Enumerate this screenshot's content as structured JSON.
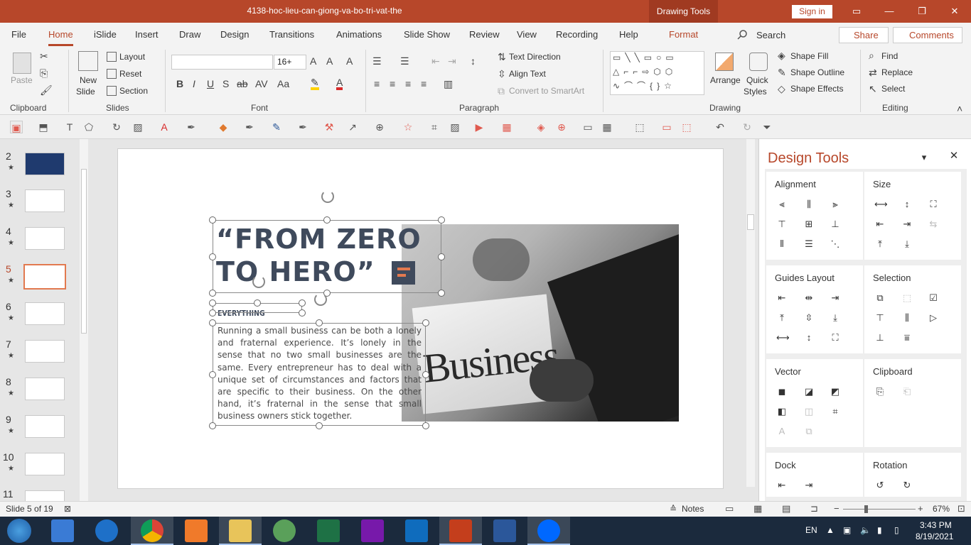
{
  "window": {
    "title": "4138-hoc-lieu-can-giong-va-bo-tri-vat-the",
    "context_tab": "Drawing Tools",
    "signin": "Sign in"
  },
  "tabs": [
    "File",
    "Home",
    "iSlide",
    "Insert",
    "Draw",
    "Design",
    "Transitions",
    "Animations",
    "Slide Show",
    "Review",
    "View",
    "Recording",
    "Help",
    "Format"
  ],
  "search_label": "Search",
  "share_label": "Share",
  "comments_label": "Comments",
  "ribbon": {
    "clipboard": {
      "label": "Clipboard",
      "paste": "Paste"
    },
    "slides": {
      "label": "Slides",
      "new_slide": "New",
      "new_slide2": "Slide",
      "layout": "Layout",
      "reset": "Reset",
      "section": "Section"
    },
    "font": {
      "label": "Font",
      "font_name": "",
      "font_size": "16+"
    },
    "paragraph": {
      "label": "Paragraph",
      "text_direction": "Text Direction",
      "align_text": "Align Text",
      "convert_smartart": "Convert to SmartArt"
    },
    "drawing": {
      "label": "Drawing",
      "arrange": "Arrange",
      "quick_styles": "Quick",
      "quick_styles2": "Styles",
      "shape_fill": "Shape Fill",
      "shape_outline": "Shape Outline",
      "shape_effects": "Shape Effects"
    },
    "editing": {
      "label": "Editing",
      "find": "Find",
      "replace": "Replace",
      "select": "Select"
    }
  },
  "thumbnails": [
    {
      "num": "2",
      "star": "★"
    },
    {
      "num": "3",
      "star": "★"
    },
    {
      "num": "4",
      "star": "★"
    },
    {
      "num": "5",
      "star": "★"
    },
    {
      "num": "6",
      "star": "★"
    },
    {
      "num": "7",
      "star": "★"
    },
    {
      "num": "8",
      "star": "★"
    },
    {
      "num": "9",
      "star": "★"
    },
    {
      "num": "10",
      "star": "★"
    },
    {
      "num": "11",
      "star": ""
    }
  ],
  "slide": {
    "title_line1": "“FROM ZERO",
    "title_line2": "TO HERO”",
    "subtitle": "EVERYTHING",
    "body": "Running a small business can be both a lonely and fraternal experience. It’s lonely in the sense that no two small businesses are the same. Every entrepreneur has to deal with a unique set of circumstances and factors that are specific to their business. On the other hand, it’s fraternal in the sense that small business owners stick together.",
    "photo_word": "Business"
  },
  "design_tools": {
    "title": "Design Tools",
    "sections": {
      "alignment": "Alignment",
      "size": "Size",
      "guides_layout": "Guides Layout",
      "selection": "Selection",
      "vector": "Vector",
      "clipboard": "Clipboard",
      "dock": "Dock",
      "rotation": "Rotation"
    }
  },
  "status": {
    "slide_of": "Slide 5 of 19",
    "notes": "Notes",
    "zoom": "67%"
  },
  "taskbar": {
    "lang": "EN",
    "time": "3:43 PM",
    "date": "8/19/2021"
  },
  "colors": {
    "accent": "#b7472a",
    "title_text": "#3f4a5c",
    "highlight": "#e2794f"
  }
}
